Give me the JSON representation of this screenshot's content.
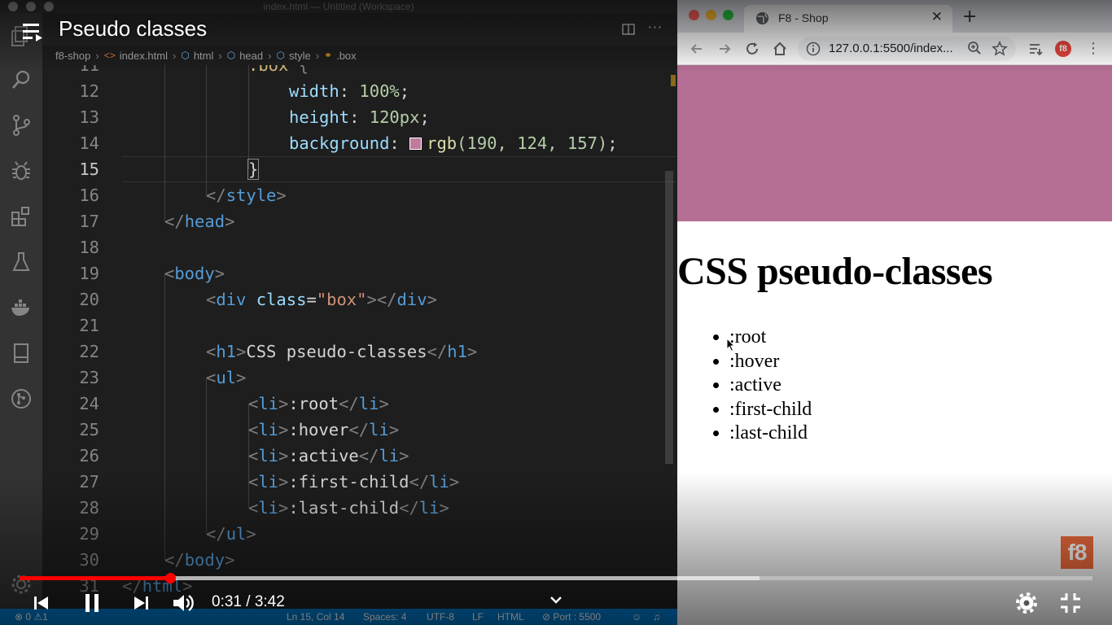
{
  "video": {
    "title": "Pseudo classes",
    "current_time": "0:31",
    "separator": " / ",
    "duration": "3:42",
    "played_fraction": 0.14,
    "buffered_fraction": 0.69
  },
  "vscode": {
    "window_title": "index.html — Untitled (Workspace)",
    "breadcrumb": [
      "f8-shop",
      "index.html",
      "html",
      "head",
      "style",
      ".box"
    ],
    "selector_text": ".box",
    "code": {
      "lines": [
        "11",
        "12",
        "13",
        "14",
        "15",
        "16",
        "17",
        "18",
        "19",
        "20",
        "21",
        "22",
        "23",
        "24",
        "25",
        "26",
        "27",
        "28",
        "29",
        "30",
        "31"
      ],
      "width_prop": "width",
      "width_val": "100%",
      "height_prop": "height",
      "height_val": "120px",
      "bg_prop": "background",
      "bg_fn": "rgb",
      "bg_args": "(190, 124, 157)",
      "close_brace": "}",
      "style_tag": "style",
      "head_tag": "head",
      "body_tag": "body",
      "div_tag": "div",
      "class_attr": "class",
      "class_val": "\"box\"",
      "h1_tag": "h1",
      "h1_text": "CSS pseudo-classes",
      "ul_tag": "ul",
      "li_tag": "li",
      "items": [
        ":root",
        ":hover",
        ":active",
        ":first-child",
        ":last-child"
      ],
      "html_tag": "html"
    },
    "status": {
      "problems": "0",
      "warnings": "1",
      "position": "Ln 15, Col 14",
      "spaces": "Spaces: 4",
      "encoding": "UTF-8",
      "eol": "LF",
      "language": "HTML",
      "port": "Port : 5500"
    }
  },
  "browser": {
    "tab_title": "F8 - Shop",
    "url": "127.0.0.1:5500/index...",
    "page": {
      "heading": "CSS pseudo-classes",
      "items": [
        ":root",
        ":hover",
        ":active",
        ":first-child",
        ":last-child"
      ],
      "box_color": "#be7c9d"
    },
    "logo_text": "f8"
  },
  "colors": {
    "vscode_status": "#007acc",
    "yt_red": "#ff0000",
    "f8_orange": "#f06b3c"
  }
}
